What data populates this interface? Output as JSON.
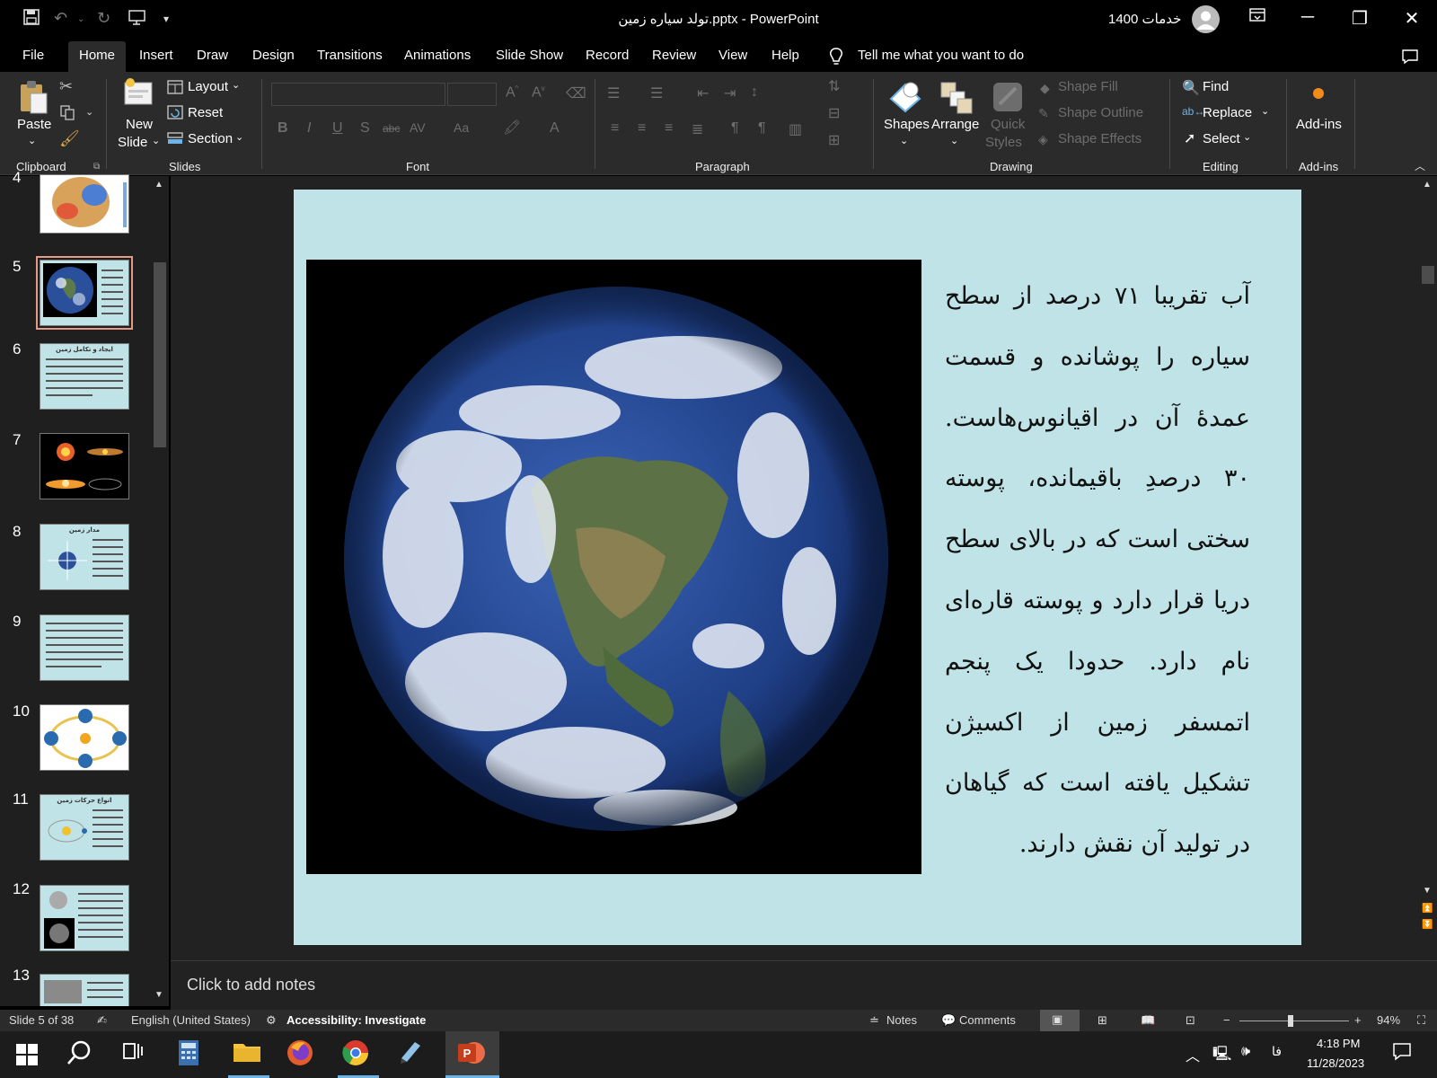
{
  "window": {
    "title": "تولد سیاره زمین.pptx  -  PowerPoint",
    "user": "خدمات 1400"
  },
  "tabs": [
    "File",
    "Home",
    "Insert",
    "Draw",
    "Design",
    "Transitions",
    "Animations",
    "Slide Show",
    "Record",
    "Review",
    "View",
    "Help"
  ],
  "tell_me": "Tell me what you want to do",
  "ribbon": {
    "clipboard": {
      "label": "Clipboard",
      "paste": "Paste"
    },
    "slides": {
      "label": "Slides",
      "new_slide_1": "New",
      "new_slide_2": "Slide",
      "layout": "Layout",
      "reset": "Reset",
      "section": "Section"
    },
    "font": {
      "label": "Font"
    },
    "paragraph": {
      "label": "Paragraph"
    },
    "drawing": {
      "label": "Drawing",
      "shapes": "Shapes",
      "arrange": "Arrange",
      "quick_styles_1": "Quick",
      "quick_styles_2": "Styles",
      "shape_fill": "Shape Fill",
      "shape_outline": "Shape Outline",
      "shape_effects": "Shape Effects"
    },
    "editing": {
      "label": "Editing",
      "find": "Find",
      "replace": "Replace",
      "select": "Select"
    },
    "addins": {
      "label": "Add-ins",
      "button": "Add-ins"
    }
  },
  "slides_panel": {
    "numbers": [
      "4",
      "5",
      "6",
      "7",
      "8",
      "9",
      "10",
      "11",
      "12",
      "13"
    ],
    "selected": "5",
    "thumb_titles": {
      "6": "ایجاد و تکامل زمین",
      "8": "مدار زمین",
      "11": "انواع حرکات زمین"
    }
  },
  "slide": {
    "body_text": "آب تقریبا ۷۱ درصد از سطح سیاره را پوشانده و قسمت عمدهٔ آن در اقیانوس‌هاست. ۳۰ درصدِ باقیمانده، پوسته سختی است که در بالای سطح دریا قرار دارد و پوسته قاره‌ای نام دارد. حدودا یک پنجم اتمسفر زمین از اکسیژن تشکیل یافته است که گیاهان در تولید آن نقش دارند."
  },
  "notes": {
    "placeholder": "Click to add notes"
  },
  "status": {
    "slide_info": "Slide 5 of 38",
    "language": "English (United States)",
    "accessibility": "Accessibility: Investigate",
    "notes": "Notes",
    "comments": "Comments",
    "zoom": "94%"
  },
  "taskbar": {
    "time": "4:18 PM",
    "date": "11/28/2023",
    "lang": "فا"
  },
  "colors": {
    "slide_bg": "#bfe3e6",
    "accent_selected_thumb": "#e59a85",
    "powerpoint_orange": "#c43e1c"
  }
}
